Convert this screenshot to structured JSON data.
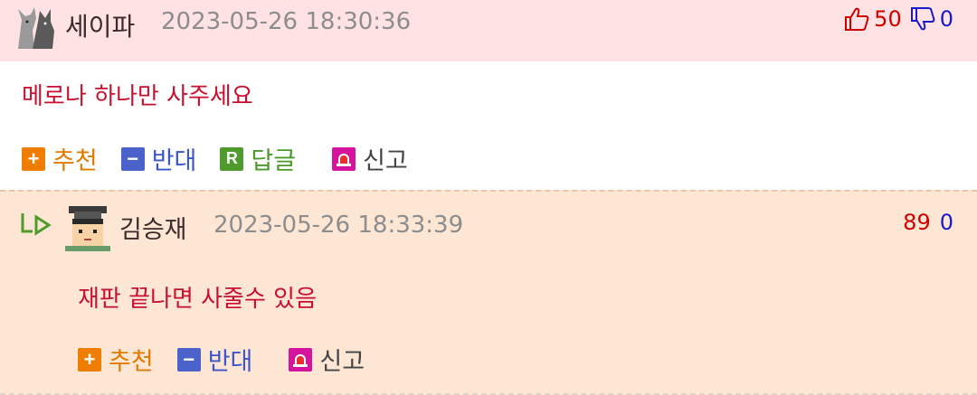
{
  "comment": {
    "nickname": "세이파",
    "date": "2023-05-26 18:30:36",
    "up_count": "50",
    "down_count": "0",
    "text": "메로나 하나만 사주세요",
    "actions": {
      "recommend": "추천",
      "oppose": "반대",
      "reply": "답글",
      "report": "신고"
    }
  },
  "reply": {
    "nickname": "김승재",
    "date": "2023-05-26 18:33:39",
    "up_count": "89",
    "down_count": "0",
    "text": "재판 끝나면 사줄수 있음",
    "actions": {
      "recommend": "추천",
      "oppose": "반대",
      "report": "신고"
    }
  },
  "colors": {
    "header_bg": "#ffe2e3",
    "reply_bg": "#fde6d4",
    "text_red": "#c8102e",
    "recommend": "#ef7d00",
    "oppose": "#4a62c9",
    "reply": "#4f9b2d",
    "report": "#d4149c"
  },
  "icons": [
    "thumbs-up-icon",
    "thumbs-down-icon",
    "plus-icon",
    "minus-icon",
    "reply-r-icon",
    "siren-icon",
    "reply-arrow-icon"
  ]
}
